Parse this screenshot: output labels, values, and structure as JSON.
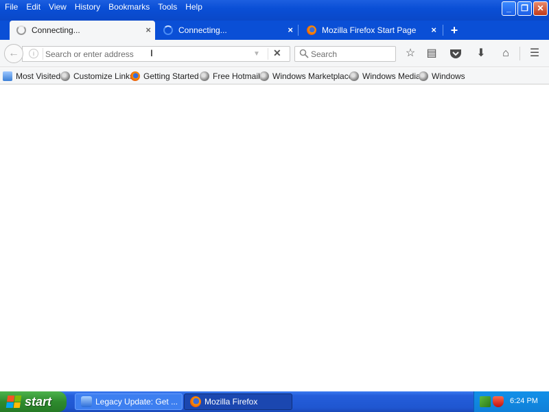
{
  "menubar": {
    "items": [
      {
        "label": "File"
      },
      {
        "label": "Edit"
      },
      {
        "label": "View"
      },
      {
        "label": "History"
      },
      {
        "label": "Bookmarks"
      },
      {
        "label": "Tools"
      },
      {
        "label": "Help"
      }
    ]
  },
  "window_controls": {
    "minimize": "minimize-icon",
    "maximize": "restore-icon",
    "close": "close-icon"
  },
  "tabs": [
    {
      "label": "Connecting...",
      "selected": true,
      "icon": "loading-spinner-icon"
    },
    {
      "label": "Connecting...",
      "selected": false,
      "icon": "loading-spinner-icon"
    },
    {
      "label": "Mozilla Firefox Start Page",
      "selected": false,
      "icon": "firefox-icon"
    }
  ],
  "urlbar": {
    "value": "",
    "placeholder": "Search or enter address"
  },
  "searchbar": {
    "value": "",
    "placeholder": "Search"
  },
  "toolbar_icons": [
    "bookmark-star-icon",
    "reading-list-icon",
    "pocket-icon",
    "downloads-icon",
    "home-icon",
    "hamburger-menu-icon"
  ],
  "bookmarks": [
    {
      "label": "Most Visited"
    },
    {
      "label": "Customize Links"
    },
    {
      "label": "Getting Started"
    },
    {
      "label": "Free Hotmail"
    },
    {
      "label": "Windows Marketplace"
    },
    {
      "label": "Windows Media"
    },
    {
      "label": "Windows"
    }
  ],
  "taskbar": {
    "start_label": "start",
    "tasks": [
      {
        "label": "Legacy Update: Get ...",
        "active": false
      },
      {
        "label": "Mozilla Firefox",
        "active": true
      }
    ],
    "clock": "6:24 PM"
  },
  "colors": {
    "titlebar_blue": "#0a4fd6",
    "taskbar_blue": "#245edb",
    "start_green": "#2e8b2e",
    "toolbar_gray": "#f5f6f7"
  }
}
